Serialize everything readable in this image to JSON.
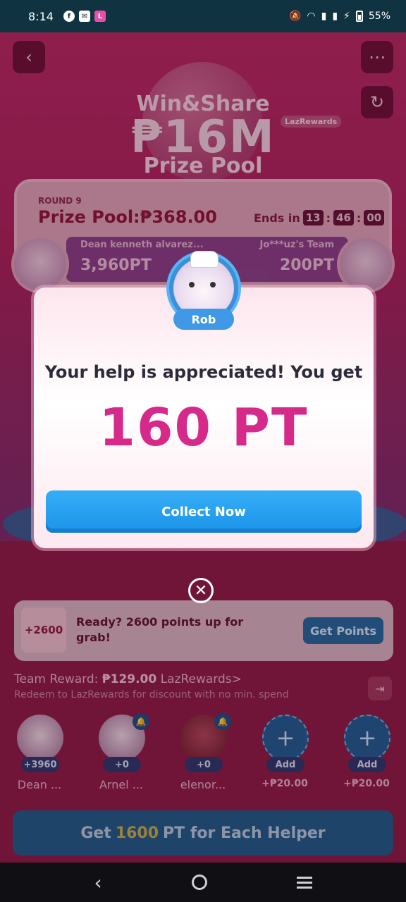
{
  "status_bar": {
    "time": "8:14",
    "battery": "55%",
    "icons": [
      "facebook-icon",
      "mail-icon",
      "lazada-icon",
      "mute-icon",
      "wifi-icon",
      "signal-icon",
      "signal-icon",
      "charging-icon",
      "battery-icon"
    ]
  },
  "background": {
    "title_line1": "Win&Share",
    "title_line2": "₱16M",
    "title_line3": "Prize Pool",
    "tag": "LazRewards",
    "round_label": "ROUND 9",
    "prize_pool": "Prize Pool:₱368.00",
    "ends_in_label": "Ends in",
    "timer": {
      "hours": "13",
      "minutes": "46",
      "seconds": "00"
    },
    "team_left": {
      "name": "Dean kenneth alvarez...",
      "points": "3,960PT"
    },
    "team_right": {
      "name": "Jo***uz's Team",
      "points": "200PT"
    },
    "promo": {
      "badge": "+2600",
      "text": "Ready? 2600 points up for grab!",
      "button": "Get Points"
    },
    "team_reward": {
      "label": "Team Reward:",
      "amount": "₱129.00",
      "link": "LazRewards>",
      "note": "Redeem to LazRewards for discount with no min. spend"
    },
    "helpers": [
      {
        "name": "Dean ...",
        "points": "+3960",
        "bell": false,
        "type": "avatar"
      },
      {
        "name": "Arnel ...",
        "points": "+0",
        "bell": true,
        "type": "avatar"
      },
      {
        "name": "elenor...",
        "points": "+0",
        "bell": true,
        "type": "photo"
      },
      {
        "name": "+₱20.00",
        "points": "Add",
        "bell": false,
        "type": "add"
      },
      {
        "name": "+₱20.00",
        "points": "Add",
        "bell": false,
        "type": "add"
      }
    ],
    "cta": {
      "prefix": "Get",
      "highlight": "1600",
      "suffix": "PT for Each Helper"
    }
  },
  "modal": {
    "helper_name": "Rob",
    "message": "Your help is appreciated! You get",
    "points": "160 PT",
    "button": "Collect Now",
    "close_icon": "close-icon"
  },
  "colors": {
    "accent_pink": "#d62a8a",
    "button_blue": "#1b93e9",
    "modal_bg": "#ffffff"
  }
}
